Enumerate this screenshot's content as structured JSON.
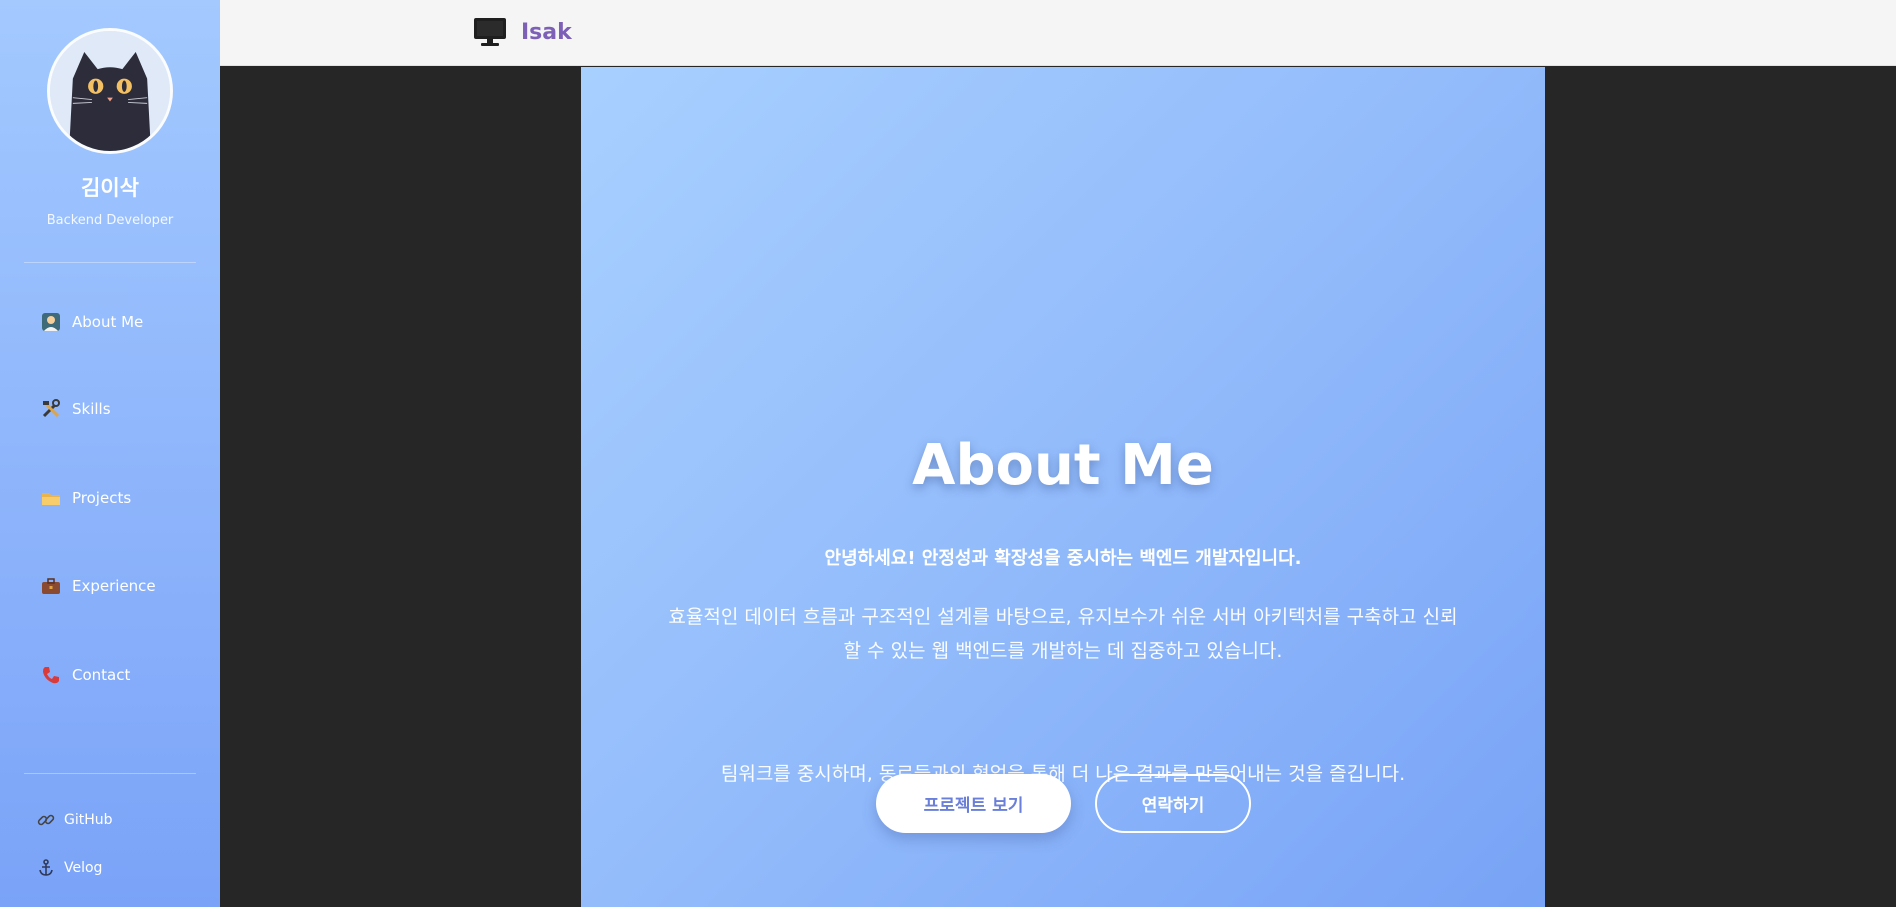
{
  "sidebar": {
    "profile": {
      "name": "김이삭",
      "role": "Backend Developer",
      "avatar_icon": "black-cat-avatar"
    },
    "nav": [
      {
        "label": "About Me",
        "icon": "person-portrait-icon"
      },
      {
        "label": "Skills",
        "icon": "tools-icon"
      },
      {
        "label": "Projects",
        "icon": "folder-icon"
      },
      {
        "label": "Experience",
        "icon": "briefcase-icon"
      },
      {
        "label": "Contact",
        "icon": "phone-icon"
      }
    ],
    "links": [
      {
        "label": "GitHub",
        "icon": "link-icon"
      },
      {
        "label": "Velog",
        "icon": "anchor-icon"
      }
    ]
  },
  "header": {
    "brand": "Isak",
    "brand_icon": "monitor-icon"
  },
  "hero": {
    "title": "About Me",
    "lead": "안녕하세요! 안정성과 확장성을 중시하는 백엔드 개발자입니다.",
    "description": "효율적인 데이터 흐름과 구조적인 설계를 바탕으로, 유지보수가 쉬운 서버 아키텍처를 구축하고 신뢰할 수 있는 웹 백엔드를 개발하는 데 집중하고 있습니다.",
    "description2": "팀워크를 중시하며, 동료들과의 협업을 통해 더 나은 결과를 만들어내는 것을 즐깁니다.",
    "buttons": {
      "primary": "프로젝트 보기",
      "secondary": "연락하기"
    }
  },
  "colors": {
    "sidebar_top": "#a3c9ff",
    "sidebar_bottom": "#7aa3f8",
    "hero_start": "#a8d0ff",
    "hero_end": "#78a3f6",
    "brand_text": "#7d5fb8",
    "primary_button_text": "#6a7fd9",
    "page_background": "#262626",
    "header_background": "#f5f5f5"
  }
}
